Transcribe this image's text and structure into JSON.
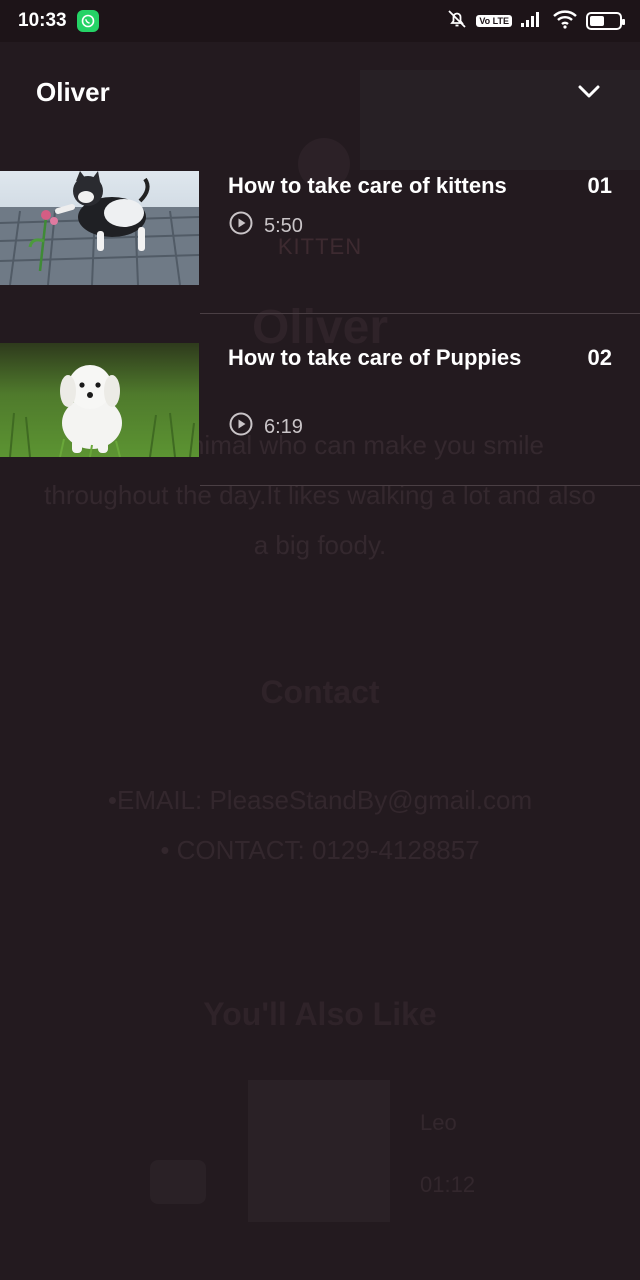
{
  "status_bar": {
    "time": "10:33",
    "volte_label": "Vo LTE",
    "battery_level": 0.5
  },
  "sheet": {
    "title": "Oliver"
  },
  "episodes": [
    {
      "title": "How to take care of kittens",
      "number": "01",
      "duration": "5:50"
    },
    {
      "title": "How to take care of Puppies",
      "number": "02",
      "duration": "6:19"
    }
  ],
  "background": {
    "tag": "KITTEN",
    "name": "Oliver",
    "description": "A cute animal who can make you smile throughout the day.It likes walking a lot and also a big foody.",
    "contact_heading": "Contact",
    "email": "•EMAIL: PleaseStandBy@gmail.com",
    "phone": "• CONTACT: 0129-4128857",
    "also_like_heading": "You'll Also Like",
    "card_name": "Leo",
    "card_number": "01:12"
  },
  "colors": {
    "background": "#231a1f",
    "status_bar": "#1d1418",
    "text": "#ffffff",
    "muted": "#c9c4c7"
  },
  "icons": [
    "whatsapp-icon",
    "mute-icon",
    "signal-icon",
    "wifi-icon",
    "battery-icon",
    "chevron-down-icon",
    "play-circle-icon"
  ]
}
